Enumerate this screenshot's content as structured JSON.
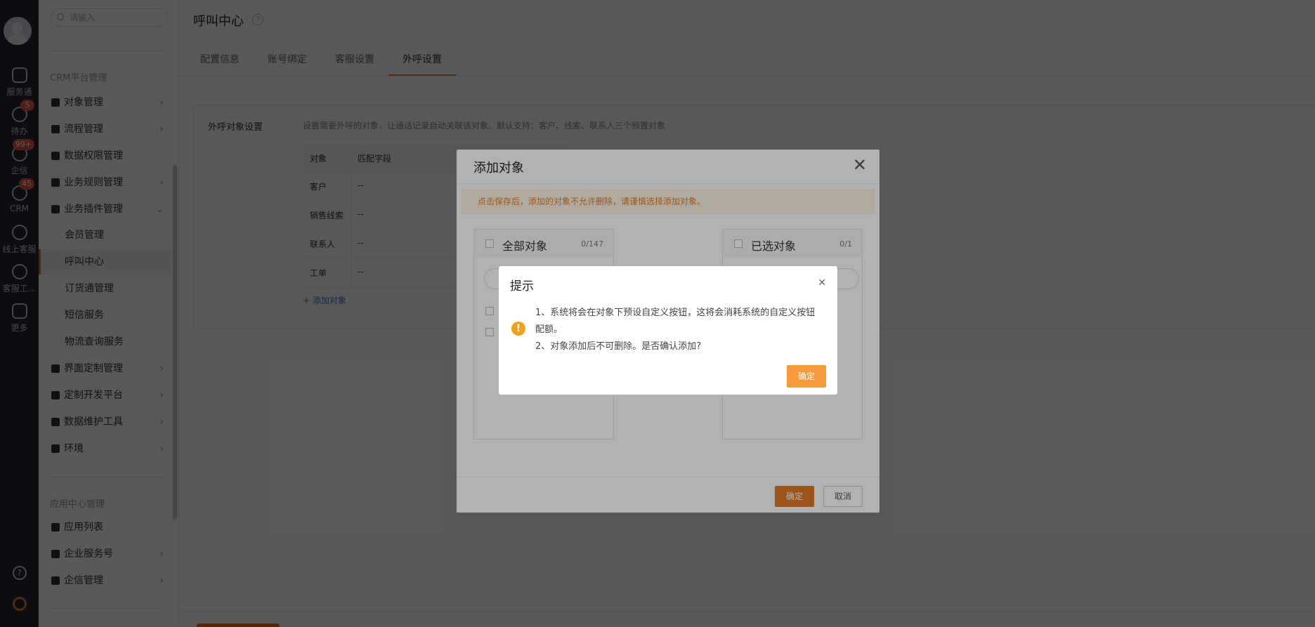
{
  "leftnav": {
    "items": [
      {
        "label": "服务通",
        "badge": ""
      },
      {
        "label": "待办",
        "badge": "5"
      },
      {
        "label": "企信",
        "badge": "99+"
      },
      {
        "label": "CRM",
        "badge": "45"
      },
      {
        "label": "线上客服",
        "badge": ""
      },
      {
        "label": "客服工...",
        "badge": ""
      },
      {
        "label": "更多",
        "badge": ""
      }
    ],
    "help_icon": "?"
  },
  "sidebar": {
    "search_placeholder": "请输入",
    "section1": "CRM平台管理",
    "section2": "应用中心管理",
    "menu1": [
      {
        "label": "对象管理",
        "chev": "›"
      },
      {
        "label": "流程管理",
        "chev": "›"
      },
      {
        "label": "数据权限管理",
        "chev": ""
      },
      {
        "label": "业务规则管理",
        "chev": "›"
      },
      {
        "label": "业务插件管理",
        "chev": "⌄"
      }
    ],
    "sub": [
      "会员管理",
      "呼叫中心",
      "订货通管理",
      "短信服务",
      "物流查询服务"
    ],
    "menu2": [
      {
        "label": "界面定制管理",
        "chev": "›"
      },
      {
        "label": "定制开发平台",
        "chev": "›"
      },
      {
        "label": "数据维护工具",
        "chev": "›"
      },
      {
        "label": "环境",
        "chev": "›"
      }
    ],
    "menu3": [
      {
        "label": "应用列表",
        "chev": ""
      },
      {
        "label": "企业服务号",
        "chev": "›"
      },
      {
        "label": "企信管理",
        "chev": "›"
      }
    ]
  },
  "main": {
    "title": "呼叫中心",
    "help": "?",
    "tabs": [
      "配置信息",
      "账号绑定",
      "客服设置",
      "外呼设置"
    ],
    "panel": {
      "label": "外呼对象设置",
      "desc": "设置需要外呼的对象，让通话记录自动关联该对象。默认支持：客户、线索、联系人三个预置对象",
      "headers": [
        "对象",
        "匹配字段"
      ],
      "rows": [
        [
          "客户",
          "--"
        ],
        [
          "销售线索",
          "--"
        ],
        [
          "联系人",
          "--"
        ],
        [
          "工单",
          "--"
        ]
      ],
      "add_link": "+ 添加对象"
    }
  },
  "add_dialog": {
    "title": "添加对象",
    "close": "✕",
    "warning": "点击保存后，添加的对象不允许删除，请谨慎选择添加对象。",
    "left": {
      "title": "全部对象",
      "count": "0/147"
    },
    "right": {
      "title": "已选对象",
      "count": "0/1"
    },
    "ok": "确定",
    "cancel": "取消"
  },
  "confirm_dialog": {
    "title": "提示",
    "close": "✕",
    "icon": "!",
    "line1": "1、系统将会在对象下预设自定义按钮，这将会消耗系统的自定义按钮配额。",
    "line2": "2、对象添加后不可删除。是否确认添加?",
    "ok": "确定"
  }
}
